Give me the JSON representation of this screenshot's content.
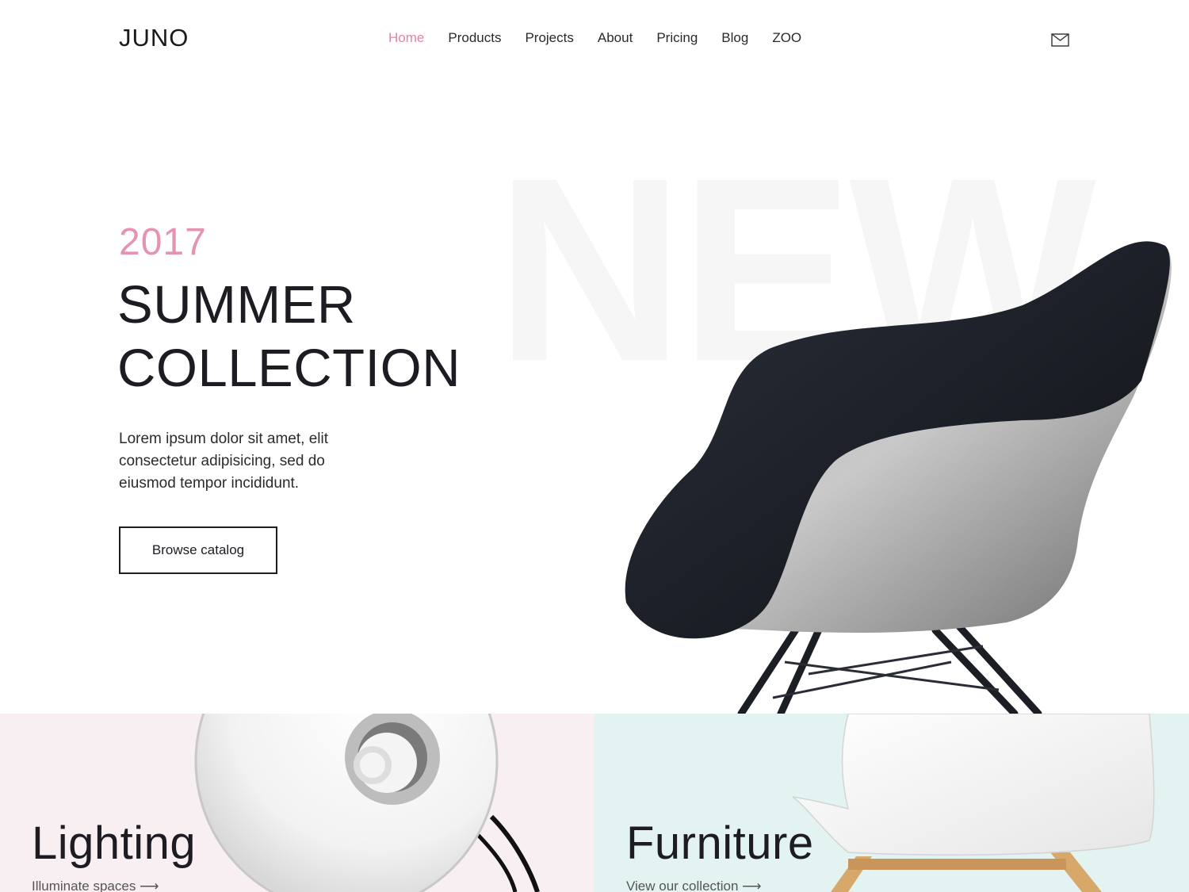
{
  "header": {
    "logo": "JUNO",
    "nav": [
      {
        "label": "Home",
        "active": true
      },
      {
        "label": "Products"
      },
      {
        "label": "Projects"
      },
      {
        "label": "About"
      },
      {
        "label": "Pricing"
      },
      {
        "label": "Blog"
      },
      {
        "label": "ZOO"
      }
    ],
    "mail_icon": "envelope-icon"
  },
  "hero": {
    "background_word": "NEW",
    "year": "2017",
    "title_line1": "SUMMER",
    "title_line2": "COLLECTION",
    "text": "Lorem ipsum dolor sit amet, elit consectetur adipisicing, sed do eiusmod tempor incididunt.",
    "button_label": "Browse catalog"
  },
  "categories": [
    {
      "title": "Lighting",
      "link": "Illuminate spaces ⟶",
      "background": "#f8eff2"
    },
    {
      "title": "Furniture",
      "link": "View our collection ⟶",
      "background": "#e3f3f1"
    }
  ],
  "colors": {
    "accent": "#e184a8",
    "dark": "#1c1c22"
  }
}
